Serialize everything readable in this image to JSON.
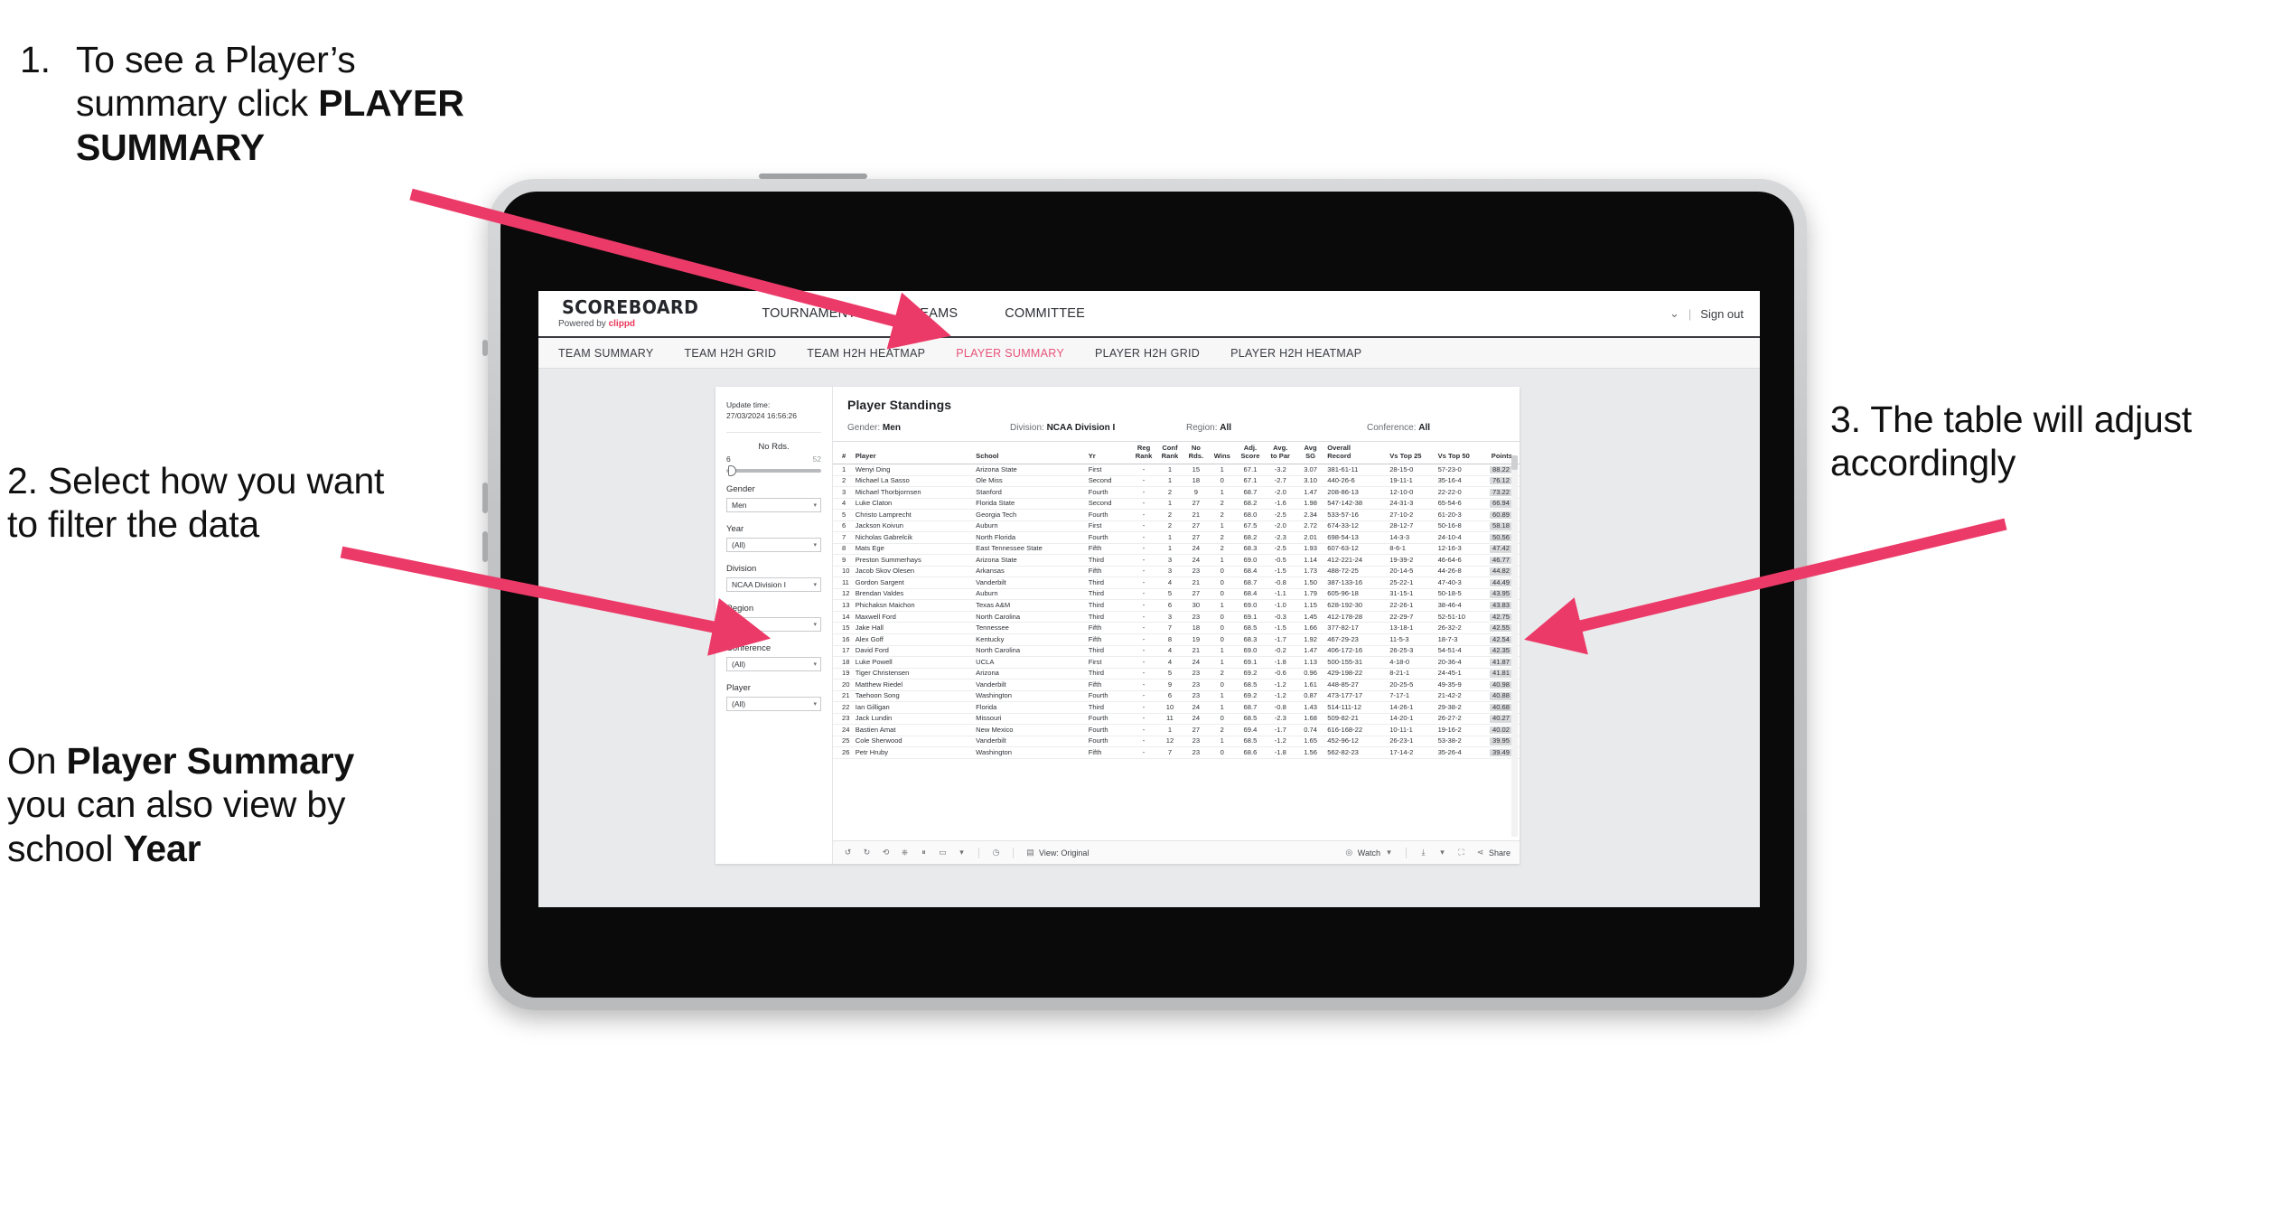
{
  "annotations": {
    "step1": {
      "num": "1.",
      "lines": [
        "To see a Player’s",
        "summary click ",
        "PLAYER SUMMARY"
      ],
      "bold_part": "PLAYER SUMMARY"
    },
    "step2": {
      "num": "2.",
      "text": "Select how you want to filter the data"
    },
    "step2b": {
      "text": "On Player Summary you can also view by school Year",
      "bold_1": "Player Summary",
      "bold_2": "Year"
    },
    "step3": {
      "num": "3.",
      "text": "The table will adjust accordingly"
    },
    "arrow_color": "#ec3a68"
  },
  "app": {
    "brand": {
      "title": "SCOREBOARD",
      "powered_prefix": "Powered by ",
      "powered_brand": "clippd"
    },
    "topnav": [
      "TOURNAMENTS",
      "TEAMS",
      "COMMITTEE"
    ],
    "topright": {
      "account": "⌄",
      "divider": "|",
      "signout": "Sign out"
    },
    "subnav": {
      "tabs": [
        "TEAM SUMMARY",
        "TEAM H2H GRID",
        "TEAM H2H HEATMAP",
        "PLAYER SUMMARY",
        "PLAYER H2H GRID",
        "PLAYER H2H HEATMAP"
      ],
      "active": "PLAYER SUMMARY",
      "active_color": "#e8537a"
    },
    "filters": {
      "update_label": "Update time:",
      "update_value": "27/03/2024 16:56:26",
      "slider": {
        "label": "No Rds.",
        "min": "6",
        "max": "52"
      },
      "groups": [
        {
          "label": "Gender",
          "value": "Men"
        },
        {
          "label": "Year",
          "value": "(All)"
        },
        {
          "label": "Division",
          "value": "NCAA Division I"
        },
        {
          "label": "Region",
          "value": "N/A"
        },
        {
          "label": "Conference",
          "value": "(All)"
        },
        {
          "label": "Player",
          "value": "(All)"
        }
      ]
    },
    "viz": {
      "title": "Player Standings",
      "summary": [
        {
          "key": "Gender:",
          "value": "Men"
        },
        {
          "key": "Division:",
          "value": "NCAA Division I"
        },
        {
          "key": "Region:",
          "value": "All"
        },
        {
          "key": "Conference:",
          "value": "All"
        }
      ],
      "columns": [
        {
          "l1": "#",
          "l2": ""
        },
        {
          "l1": "Player",
          "l2": ""
        },
        {
          "l1": "School",
          "l2": ""
        },
        {
          "l1": "Yr",
          "l2": ""
        },
        {
          "l1": "Reg",
          "l2": "Rank"
        },
        {
          "l1": "Conf",
          "l2": "Rank"
        },
        {
          "l1": "No",
          "l2": "Rds."
        },
        {
          "l1": "Wins",
          "l2": ""
        },
        {
          "l1": "Adj.",
          "l2": "Score"
        },
        {
          "l1": "Avg.",
          "l2": "to Par"
        },
        {
          "l1": "Avg",
          "l2": "SG"
        },
        {
          "l1": "Overall",
          "l2": "Record"
        },
        {
          "l1": "Vs Top 25",
          "l2": ""
        },
        {
          "l1": "Vs Top 50",
          "l2": ""
        },
        {
          "l1": "Points",
          "l2": ""
        }
      ],
      "rows": [
        [
          "1",
          "Wenyi Ding",
          "Arizona State",
          "First",
          "-",
          "1",
          "15",
          "1",
          "67.1",
          "-3.2",
          "3.07",
          "381-61-11",
          "28-15-0",
          "57-23-0",
          "88.22"
        ],
        [
          "2",
          "Michael La Sasso",
          "Ole Miss",
          "Second",
          "-",
          "1",
          "18",
          "0",
          "67.1",
          "-2.7",
          "3.10",
          "440-26-6",
          "19-11-1",
          "35-16-4",
          "76.12"
        ],
        [
          "3",
          "Michael Thorbjornsen",
          "Stanford",
          "Fourth",
          "-",
          "2",
          "9",
          "1",
          "68.7",
          "-2.0",
          "1.47",
          "208-86-13",
          "12-10-0",
          "22-22-0",
          "73.22"
        ],
        [
          "4",
          "Luke Claton",
          "Florida State",
          "Second",
          "-",
          "1",
          "27",
          "2",
          "68.2",
          "-1.6",
          "1.98",
          "547-142-38",
          "24-31-3",
          "65-54-6",
          "66.94"
        ],
        [
          "5",
          "Christo Lamprecht",
          "Georgia Tech",
          "Fourth",
          "-",
          "2",
          "21",
          "2",
          "68.0",
          "-2.5",
          "2.34",
          "533-57-16",
          "27-10-2",
          "61-20-3",
          "60.89"
        ],
        [
          "6",
          "Jackson Koivun",
          "Auburn",
          "First",
          "-",
          "2",
          "27",
          "1",
          "67.5",
          "-2.0",
          "2.72",
          "674-33-12",
          "28-12-7",
          "50-16-8",
          "58.18"
        ],
        [
          "7",
          "Nicholas Gabrelcik",
          "North Florida",
          "Fourth",
          "-",
          "1",
          "27",
          "2",
          "68.2",
          "-2.3",
          "2.01",
          "698-54-13",
          "14-3-3",
          "24-10-4",
          "50.56"
        ],
        [
          "8",
          "Mats Ege",
          "East Tennessee State",
          "Fifth",
          "-",
          "1",
          "24",
          "2",
          "68.3",
          "-2.5",
          "1.93",
          "607-63-12",
          "8-6-1",
          "12-16-3",
          "47.42"
        ],
        [
          "9",
          "Preston Summerhays",
          "Arizona State",
          "Third",
          "-",
          "3",
          "24",
          "1",
          "69.0",
          "-0.5",
          "1.14",
          "412-221-24",
          "19-39-2",
          "46-64-6",
          "46.77"
        ],
        [
          "10",
          "Jacob Skov Olesen",
          "Arkansas",
          "Fifth",
          "-",
          "3",
          "23",
          "0",
          "68.4",
          "-1.5",
          "1.73",
          "488-72-25",
          "20-14-5",
          "44-26-8",
          "44.82"
        ],
        [
          "11",
          "Gordon Sargent",
          "Vanderbilt",
          "Third",
          "-",
          "4",
          "21",
          "0",
          "68.7",
          "-0.8",
          "1.50",
          "387-133-16",
          "25-22-1",
          "47-40-3",
          "44.49"
        ],
        [
          "12",
          "Brendan Valdes",
          "Auburn",
          "Third",
          "-",
          "5",
          "27",
          "0",
          "68.4",
          "-1.1",
          "1.79",
          "605-96-18",
          "31-15-1",
          "50-18-5",
          "43.95"
        ],
        [
          "13",
          "Phichaksn Maichon",
          "Texas A&M",
          "Third",
          "-",
          "6",
          "30",
          "1",
          "69.0",
          "-1.0",
          "1.15",
          "628-192-30",
          "22-26-1",
          "38-46-4",
          "43.83"
        ],
        [
          "14",
          "Maxwell Ford",
          "North Carolina",
          "Third",
          "-",
          "3",
          "23",
          "0",
          "69.1",
          "-0.3",
          "1.45",
          "412-178-28",
          "22-29-7",
          "52-51-10",
          "42.75"
        ],
        [
          "15",
          "Jake Hall",
          "Tennessee",
          "Fifth",
          "-",
          "7",
          "18",
          "0",
          "68.5",
          "-1.5",
          "1.66",
          "377-82-17",
          "13-18-1",
          "26-32-2",
          "42.55"
        ],
        [
          "16",
          "Alex Goff",
          "Kentucky",
          "Fifth",
          "-",
          "8",
          "19",
          "0",
          "68.3",
          "-1.7",
          "1.92",
          "467-29-23",
          "11-5-3",
          "18-7-3",
          "42.54"
        ],
        [
          "17",
          "David Ford",
          "North Carolina",
          "Third",
          "-",
          "4",
          "21",
          "1",
          "69.0",
          "-0.2",
          "1.47",
          "406-172-16",
          "26-25-3",
          "54-51-4",
          "42.35"
        ],
        [
          "18",
          "Luke Powell",
          "UCLA",
          "First",
          "-",
          "4",
          "24",
          "1",
          "69.1",
          "-1.8",
          "1.13",
          "500-155-31",
          "4-18-0",
          "20-36-4",
          "41.87"
        ],
        [
          "19",
          "Tiger Christensen",
          "Arizona",
          "Third",
          "-",
          "5",
          "23",
          "2",
          "69.2",
          "-0.6",
          "0.96",
          "429-198-22",
          "8-21-1",
          "24-45-1",
          "41.81"
        ],
        [
          "20",
          "Matthew Riedel",
          "Vanderbilt",
          "Fifth",
          "-",
          "9",
          "23",
          "0",
          "68.5",
          "-1.2",
          "1.61",
          "448-85-27",
          "20-25-5",
          "49-35-9",
          "40.98"
        ],
        [
          "21",
          "Taehoon Song",
          "Washington",
          "Fourth",
          "-",
          "6",
          "23",
          "1",
          "69.2",
          "-1.2",
          "0.87",
          "473-177-17",
          "7-17-1",
          "21-42-2",
          "40.88"
        ],
        [
          "22",
          "Ian Gilligan",
          "Florida",
          "Third",
          "-",
          "10",
          "24",
          "1",
          "68.7",
          "-0.8",
          "1.43",
          "514-111-12",
          "14-26-1",
          "29-38-2",
          "40.68"
        ],
        [
          "23",
          "Jack Lundin",
          "Missouri",
          "Fourth",
          "-",
          "11",
          "24",
          "0",
          "68.5",
          "-2.3",
          "1.68",
          "509-82-21",
          "14-20-1",
          "26-27-2",
          "40.27"
        ],
        [
          "24",
          "Bastien Amat",
          "New Mexico",
          "Fourth",
          "-",
          "1",
          "27",
          "2",
          "69.4",
          "-1.7",
          "0.74",
          "616-168-22",
          "10-11-1",
          "19-16-2",
          "40.02"
        ],
        [
          "25",
          "Cole Sherwood",
          "Vanderbilt",
          "Fourth",
          "-",
          "12",
          "23",
          "1",
          "68.5",
          "-1.2",
          "1.65",
          "452-96-12",
          "26-23-1",
          "53-38-2",
          "39.95"
        ],
        [
          "26",
          "Petr Hruby",
          "Washington",
          "Fifth",
          "-",
          "7",
          "23",
          "0",
          "68.6",
          "-1.8",
          "1.56",
          "562-82-23",
          "17-14-2",
          "35-26-4",
          "39.49"
        ]
      ]
    },
    "footer": {
      "view_label": "View: Original",
      "watch_label": "Watch",
      "share_label": "Share"
    }
  }
}
